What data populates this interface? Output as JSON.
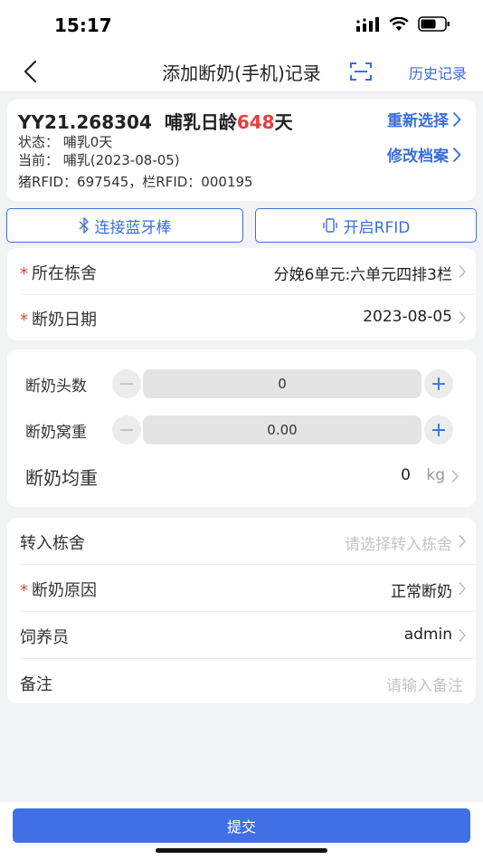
{
  "status_bar": {
    "time": "15:17"
  },
  "nav": {
    "title": "添加断奶(手机)记录",
    "history": "历史记录"
  },
  "pig": {
    "code": "YY21.268304",
    "age_label": "哺乳日龄",
    "age_value": "648",
    "age_unit": "天",
    "status": "状态： 哺乳0天",
    "current": "当前： 哺乳(2023-08-05)",
    "rfid": "猪RFID：697545，栏RFID：000195",
    "reselect": "重新选择",
    "edit_profile": "修改档案"
  },
  "buttons": {
    "bluetooth": "连接蓝牙棒",
    "rfid": "开启RFID"
  },
  "form1": {
    "barn_label": "所在栋舍",
    "barn_value": "分娩6单元:六单元四排3栏",
    "date_label": "断奶日期",
    "date_value": "2023-08-05"
  },
  "form2": {
    "head_label": "断奶头数",
    "head_value": "0",
    "weight_label": "断奶窝重",
    "weight_value": "0.00",
    "avg_label": "断奶均重",
    "avg_value": "0",
    "avg_unit": "kg"
  },
  "form3": {
    "transfer_label": "转入栋舍",
    "transfer_placeholder": "请选择转入栋舍",
    "reason_label": "断奶原因",
    "reason_value": "正常断奶",
    "feeder_label": "饲养员",
    "feeder_value": "admin",
    "remark_label": "备注",
    "remark_placeholder": "请输入备注"
  },
  "submit": "提交",
  "colors": {
    "accent": "#3a6fd8",
    "required": "#e0403c",
    "submit_bg": "#4170e6"
  },
  "icons": [
    "signal-icon",
    "wifi-icon",
    "battery-icon",
    "back-icon",
    "scan-icon",
    "bluetooth-icon",
    "rfid-icon",
    "chevron-right-icon",
    "minus-icon",
    "plus-icon"
  ]
}
